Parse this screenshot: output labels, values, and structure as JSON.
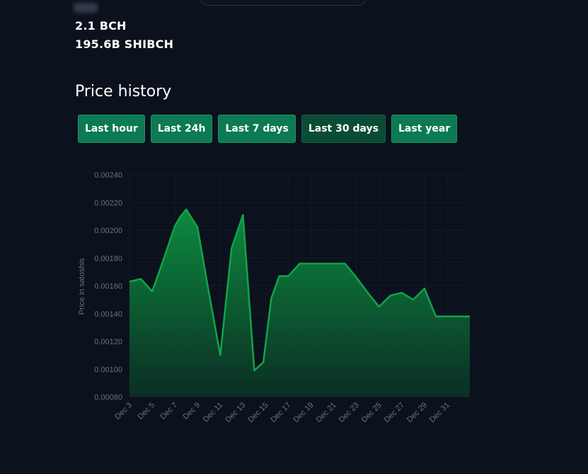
{
  "balances": {
    "bch": "2.1 BCH",
    "token": "195.6B SHIBCH"
  },
  "price_history": {
    "title": "Price history",
    "ranges": [
      "Last hour",
      "Last 24h",
      "Last 7 days",
      "Last 30 days",
      "Last year"
    ],
    "active_range": "Last 30 days"
  },
  "colors": {
    "line": "#0fa548",
    "fill_top": "#0d8a3f",
    "fill_bottom": "#0b2e24",
    "button": "#0c7a52",
    "button_active": "#0a4c36"
  },
  "chart_data": {
    "type": "area",
    "ylabel": "Price in satoshis",
    "ylim": [
      0.0008,
      0.0024
    ],
    "yticks": [
      "0.00080",
      "0.00100",
      "0.00120",
      "0.00140",
      "0.00160",
      "0.00180",
      "0.00200",
      "0.00220",
      "0.00240"
    ],
    "xtick_labels": [
      "Dec 3",
      "Dec 5",
      "Dec 7",
      "Dec 9",
      "Dec 11",
      "Dec 13",
      "Dec 15",
      "Dec 17",
      "Dec 19",
      "Dec 21",
      "Dec 23",
      "Dec 25",
      "Dec 27",
      "Dec 29",
      "Dec 31"
    ],
    "x": [
      3,
      4,
      5,
      6,
      7,
      7.5,
      8,
      9,
      10,
      11,
      12,
      13,
      14,
      14.8,
      15.5,
      16.2,
      17,
      18,
      19,
      20,
      21,
      22,
      23,
      24,
      25,
      26,
      27,
      28,
      29,
      30,
      31,
      32,
      33
    ],
    "values": [
      0.00163,
      0.00165,
      0.00156,
      0.00179,
      0.00203,
      0.0021,
      0.00215,
      0.00202,
      0.00155,
      0.0011,
      0.00187,
      0.00211,
      0.00099,
      0.00105,
      0.00151,
      0.00167,
      0.00167,
      0.00176,
      0.00176,
      0.00176,
      0.00176,
      0.00176,
      0.00166,
      0.00155,
      0.00145,
      0.00153,
      0.00155,
      0.0015,
      0.00158,
      0.00138,
      0.00138,
      0.00138,
      0.00138
    ],
    "grid": true
  }
}
